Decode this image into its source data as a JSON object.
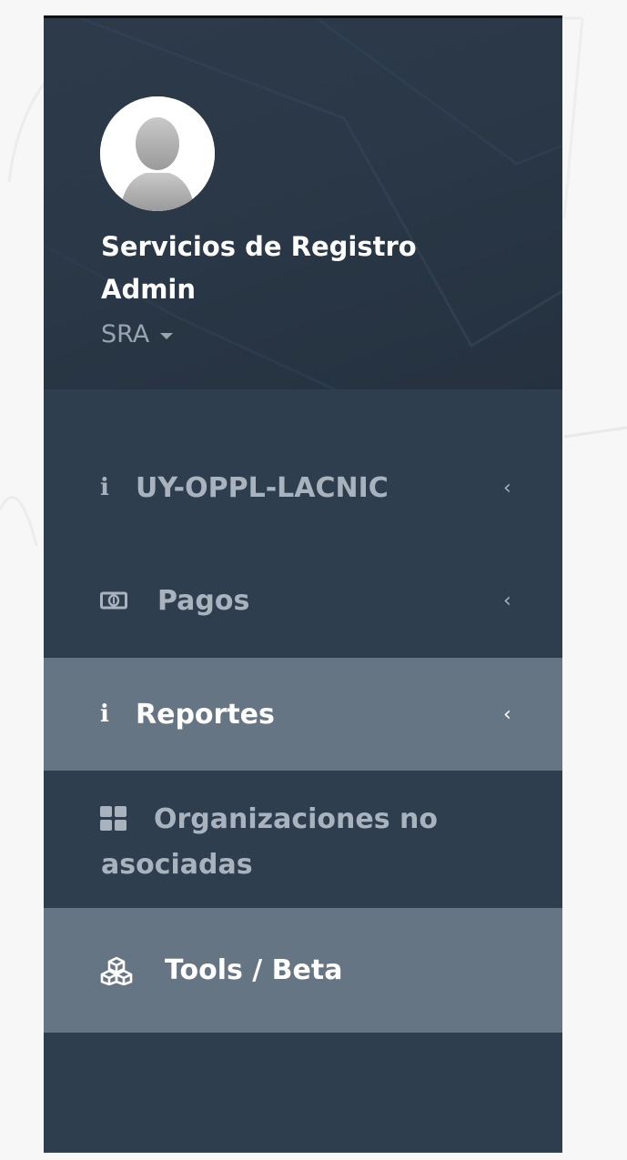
{
  "user": {
    "name": "Servicios de Registro Admin",
    "role": "SRA"
  },
  "menu": [
    {
      "label": "UY-OPPL-LACNIC",
      "icon": "info-icon",
      "active": false,
      "has_submenu": true
    },
    {
      "label": "Pagos",
      "icon": "money-icon",
      "active": false,
      "has_submenu": true
    },
    {
      "label": "Reportes",
      "icon": "info-icon",
      "active": true,
      "has_submenu": true
    },
    {
      "label": "Organizaciones no asociadas",
      "icon": "grid-icon",
      "active": false,
      "has_submenu": false
    },
    {
      "label": "Tools / Beta",
      "icon": "cubes-icon",
      "active": true,
      "has_submenu": false
    }
  ],
  "glyphs": {
    "info": "i",
    "chevron": "‹"
  },
  "colors": {
    "sidebar_bg": "#2e3e4f",
    "active_bg": "#667584",
    "text_muted": "#a9b3bd",
    "text_active": "#ffffff"
  }
}
